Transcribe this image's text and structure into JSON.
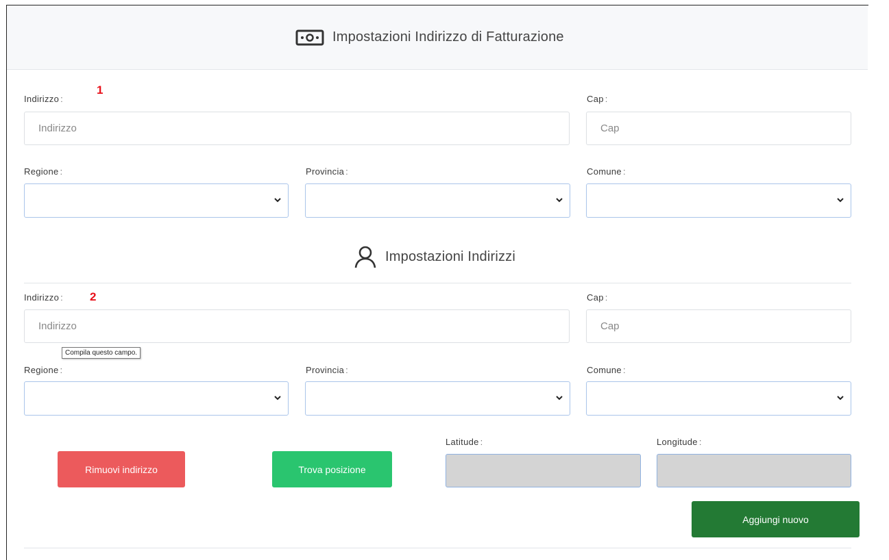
{
  "colors": {
    "danger": "#ec5a5c",
    "success": "#2ac56f",
    "primary_dark": "#237a34",
    "marker": "#e8101a"
  },
  "billing": {
    "title": "Impostazioni Indirizzo di Fatturazione",
    "icon": "banknote-icon",
    "marker": "1",
    "address_label": "Indirizzo",
    "address_placeholder": "Indirizzo",
    "cap_label": "Cap",
    "cap_placeholder": "Cap",
    "region_label": "Regione",
    "province_label": "Provincia",
    "comune_label": "Comune"
  },
  "addresses": {
    "title": "Impostazioni Indirizzi",
    "icon": "user-icon",
    "marker": "2",
    "address_label": "Indirizzo",
    "address_placeholder": "Indirizzo",
    "cap_label": "Cap",
    "cap_placeholder": "Cap",
    "tooltip": "Compila questo campo.",
    "region_label": "Regione",
    "province_label": "Provincia",
    "comune_label": "Comune",
    "latitude_label": "Latitude",
    "longitude_label": "Longitude",
    "remove_button": "Rimuovi indirizzo",
    "find_button": "Trova posizione"
  },
  "add_new_button": "Aggiungi nuovo"
}
